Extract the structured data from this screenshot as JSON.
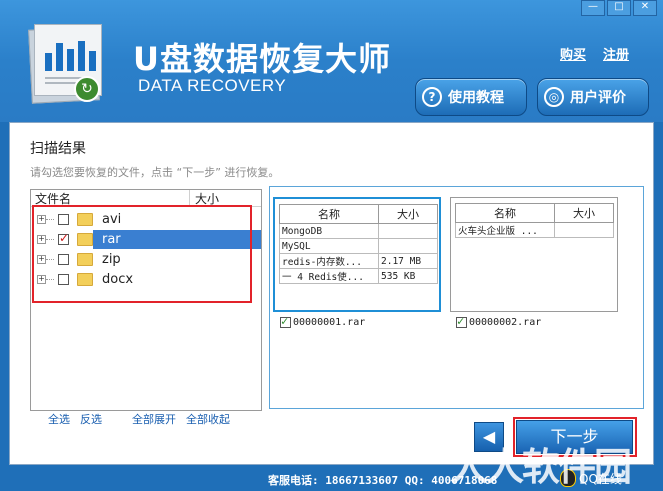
{
  "window": {
    "minimize": "—",
    "restore": "□",
    "close": "✕"
  },
  "brand": {
    "title": "U盘数据恢复大师",
    "subtitle": "DATA RECOVERY"
  },
  "top_links": {
    "buy": "购买",
    "register": "注册"
  },
  "buttons": {
    "tutorial": "使用教程",
    "review": "用户评价",
    "next": "下一步",
    "back": "◀"
  },
  "scan": {
    "title": "扫描结果",
    "hint": "请勾选您要恢复的文件，点击 “下一步” 进行恢复。",
    "columns": {
      "name": "文件名",
      "size": "大小"
    },
    "items": [
      {
        "label": "avi",
        "checked": false
      },
      {
        "label": "rar",
        "checked": true
      },
      {
        "label": "zip",
        "checked": false
      },
      {
        "label": "docx",
        "checked": false
      }
    ],
    "links": {
      "select_all": "全选",
      "invert": "反选",
      "expand_all": "全部展开",
      "collapse_all": "全部收起"
    }
  },
  "previews": [
    {
      "columns": {
        "name": "名称",
        "size": "大小"
      },
      "rows": [
        {
          "name": "MongoDB",
          "size": ""
        },
        {
          "name": "MySQL",
          "size": ""
        },
        {
          "name": "redis-内存数...",
          "size": "2.17 MB"
        },
        {
          "name": "一 4 Redis使...",
          "size": "535 KB"
        }
      ],
      "file": "00000001.rar"
    },
    {
      "columns": {
        "name": "名称",
        "size": "大小"
      },
      "rows": [
        {
          "name": "火车头企业版 ...",
          "size": ""
        }
      ],
      "file": "00000002.rar"
    }
  ],
  "footer": {
    "text": "客服电话: 18667133607 QQ: 4006718068",
    "qq_label": "QQ在线",
    "watermark": "人人软件园"
  },
  "colors": {
    "accent": "#2b80ca",
    "highlight": "#e2232a",
    "selection": "#3a7fd1"
  }
}
